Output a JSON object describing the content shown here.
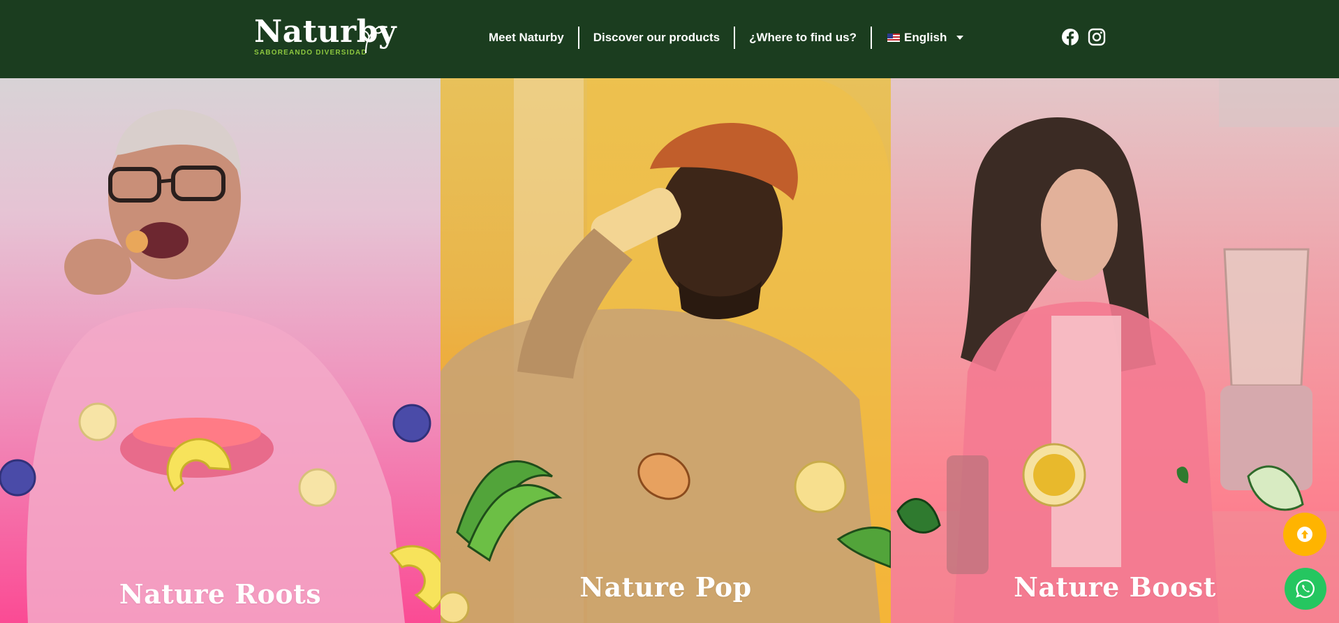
{
  "brand": {
    "name": "Naturby",
    "tagline": "SABOREANDO DIVERSIDAD"
  },
  "nav": {
    "items": [
      {
        "label": "Meet Naturby"
      },
      {
        "label": "Discover our products"
      },
      {
        "label": "¿Where to find us?"
      }
    ],
    "language": {
      "label": "English",
      "flag_icon": "us-flag-icon"
    }
  },
  "social": {
    "icons": [
      "facebook-icon",
      "instagram-icon"
    ]
  },
  "panels": [
    {
      "title": "Nature Roots",
      "color": "#fb4b94"
    },
    {
      "title": "Nature Pop",
      "color": "#ff9a0d"
    },
    {
      "title": "Nature Boost",
      "color": "#ff6f86"
    }
  ],
  "floating": {
    "scroll_top_icon": "arrow-up-icon",
    "whatsapp_icon": "whatsapp-icon"
  },
  "colors": {
    "header_bg": "#1b3d1f",
    "tagline": "#8cc63f",
    "scroll_top_bg": "#ffb400",
    "whatsapp_bg": "#25c660"
  }
}
